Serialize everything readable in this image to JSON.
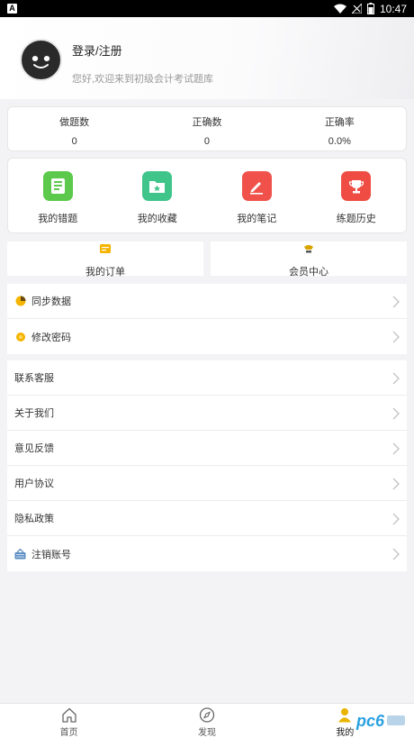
{
  "status_bar": {
    "time": "10:47",
    "left_badge": "A"
  },
  "profile": {
    "login_label": "登录/注册",
    "welcome": "您好,欢迎来到初级会计考试题库"
  },
  "stats": [
    {
      "label": "做题数",
      "value": "0"
    },
    {
      "label": "正确数",
      "value": "0"
    },
    {
      "label": "正确率",
      "value": "0.0%"
    }
  ],
  "quick_actions": [
    {
      "label": "我的错题",
      "icon": "notebook-icon",
      "color": "#5cc94d"
    },
    {
      "label": "我的收藏",
      "icon": "star-folder-icon",
      "color": "#3fc48a"
    },
    {
      "label": "我的笔记",
      "icon": "pencil-icon",
      "color": "#f0524b"
    },
    {
      "label": "练题历史",
      "icon": "trophy-icon",
      "color": "#ef4c43"
    }
  ],
  "orders": {
    "label": "我的订单",
    "icon": "order-icon",
    "color": "#f5b400"
  },
  "member": {
    "label": "会员中心",
    "icon": "crown-icon",
    "color": "#d9a400"
  },
  "menu_group_1": [
    {
      "label": "同步数据",
      "icon": "sync-pie-icon"
    },
    {
      "label": "修改密码",
      "icon": "key-badge-icon"
    }
  ],
  "menu_group_2": [
    {
      "label": "联系客服"
    },
    {
      "label": "关于我们"
    },
    {
      "label": "意见反馈"
    },
    {
      "label": "用户协议"
    },
    {
      "label": "隐私政策"
    },
    {
      "label": "注销账号",
      "icon": "basket-icon"
    }
  ],
  "tabs": [
    {
      "label": "首页",
      "icon": "home-icon"
    },
    {
      "label": "发现",
      "icon": "compass-icon"
    },
    {
      "label": "我的",
      "icon": "user-icon",
      "active": true
    }
  ],
  "watermark": "pc6"
}
